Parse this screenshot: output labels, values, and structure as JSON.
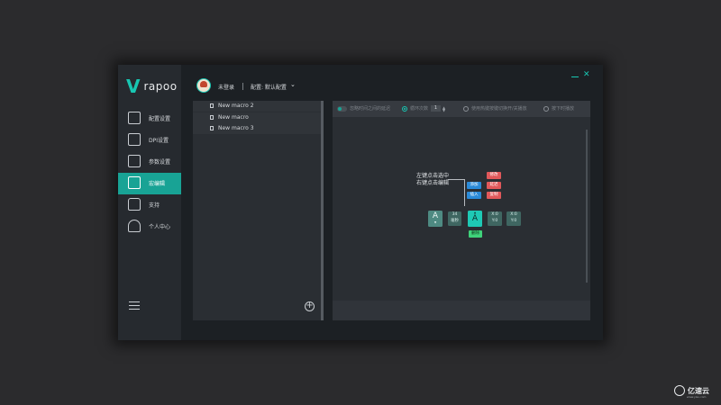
{
  "app": {
    "brand": "rapoo",
    "accent": "#18c6b2",
    "active_nav_color": "#18a395"
  },
  "sidebar": {
    "items": [
      {
        "label": "配置设置",
        "icon": "profile-settings-icon"
      },
      {
        "label": "DPI设置",
        "icon": "dpi-icon"
      },
      {
        "label": "参数设置",
        "icon": "parameter-icon"
      },
      {
        "label": "宏编辑",
        "icon": "macro-edit-icon",
        "active": true
      },
      {
        "label": "支持",
        "icon": "thumbs-up-icon"
      },
      {
        "label": "个人中心",
        "icon": "user-center-icon"
      }
    ],
    "collapse_icon": "collapse-menu-icon"
  },
  "topbar": {
    "user": "未登录",
    "separator": "|",
    "config": "配置: 默认配置",
    "config_icon": "chevron-down-icon",
    "minimize_icon": "minimize-icon",
    "close_icon": "close-icon"
  },
  "macros": {
    "items": [
      {
        "name": "New macro 2"
      },
      {
        "name": "New macro"
      },
      {
        "name": "New macro 3"
      }
    ],
    "add_icon": "plus-circle-icon"
  },
  "toolbar": {
    "ignore_delay": "忽略时间之间的延迟",
    "loop_count": "循环次数",
    "loop_value": "1",
    "toggle_play": "使用热键按键切换开/关播放",
    "release_stop": "按下时播放"
  },
  "editor": {
    "hint_select": "左键点击选中",
    "hint_edit": "右键点击编辑",
    "key1": "A",
    "delay_value": "34",
    "delay_unit": "毫秒",
    "key2": "A",
    "x1": "X:0",
    "y1": "Y:0",
    "x2": "X:0",
    "y2": "Y:0",
    "btn_add": "添加",
    "btn_insert": "插入",
    "btn_modify": "修改",
    "btn_delay": "延迟",
    "btn_delete_red": "复制",
    "btn_delete": "删除"
  },
  "watermark": {
    "brand": "亿速云",
    "url": "www.yisu.com"
  }
}
